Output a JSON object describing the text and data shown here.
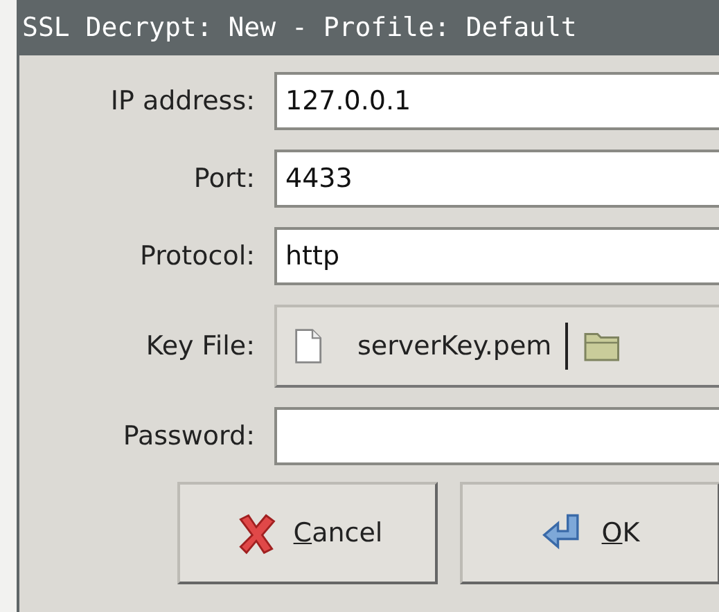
{
  "window": {
    "title": "SSL Decrypt: New - Profile: Default"
  },
  "fields": [
    {
      "kind": "entry",
      "label": "IP address:",
      "value": "127.0.0.1"
    },
    {
      "kind": "entry",
      "label": "Port:",
      "value": "4433"
    },
    {
      "kind": "entry",
      "label": "Protocol:",
      "value": "http"
    },
    {
      "kind": "file",
      "label": "Key File:",
      "value": "serverKey.pem"
    },
    {
      "kind": "entry",
      "label": "Password:"
    }
  ],
  "buttons": [
    {
      "kind": "cancel",
      "mnemonic": "C",
      "rest": "ancel"
    },
    {
      "kind": "ok",
      "mnemonic": "O",
      "rest": "K"
    }
  ]
}
